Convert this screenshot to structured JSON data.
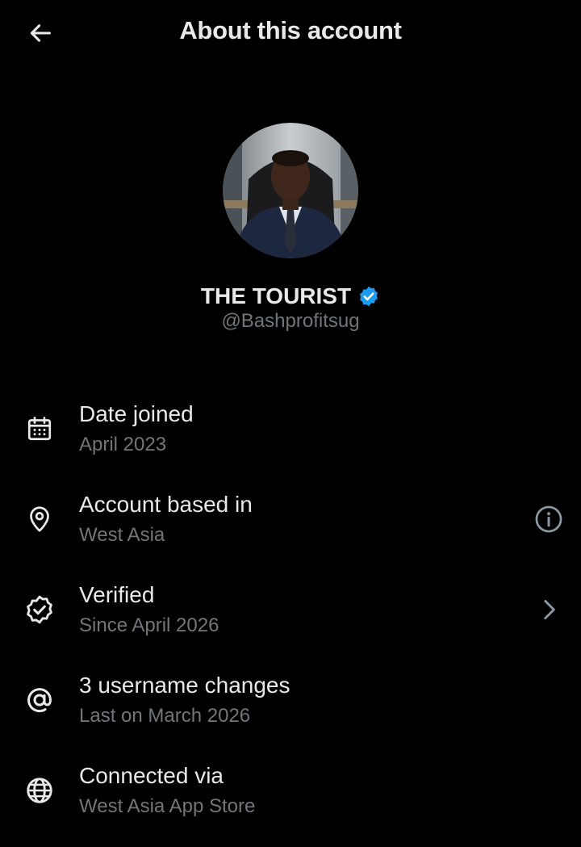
{
  "header": {
    "title": "About this account",
    "back_icon": "arrow-left-icon"
  },
  "profile": {
    "display_name": "THE TOURIST",
    "handle": "@Bashprofitsug",
    "verified": true,
    "verified_color": "#1d9bf0"
  },
  "details": [
    {
      "icon": "calendar-icon",
      "title": "Date joined",
      "subtitle": "April 2023"
    },
    {
      "icon": "location-pin-icon",
      "title": "Account based in",
      "subtitle": "West Asia",
      "action_icon": "info-icon"
    },
    {
      "icon": "verified-badge-icon",
      "title": "Verified",
      "subtitle": "Since April 2026",
      "action_icon": "chevron-right-icon"
    },
    {
      "icon": "at-sign-icon",
      "title": "3 username changes",
      "subtitle": "Last on March 2026"
    },
    {
      "icon": "globe-icon",
      "title": "Connected via",
      "subtitle": "West Asia App Store"
    }
  ],
  "colors": {
    "background": "#000000",
    "primary_text": "#e7e9ea",
    "secondary_text": "#71767b",
    "accent_blue": "#1d9bf0"
  }
}
